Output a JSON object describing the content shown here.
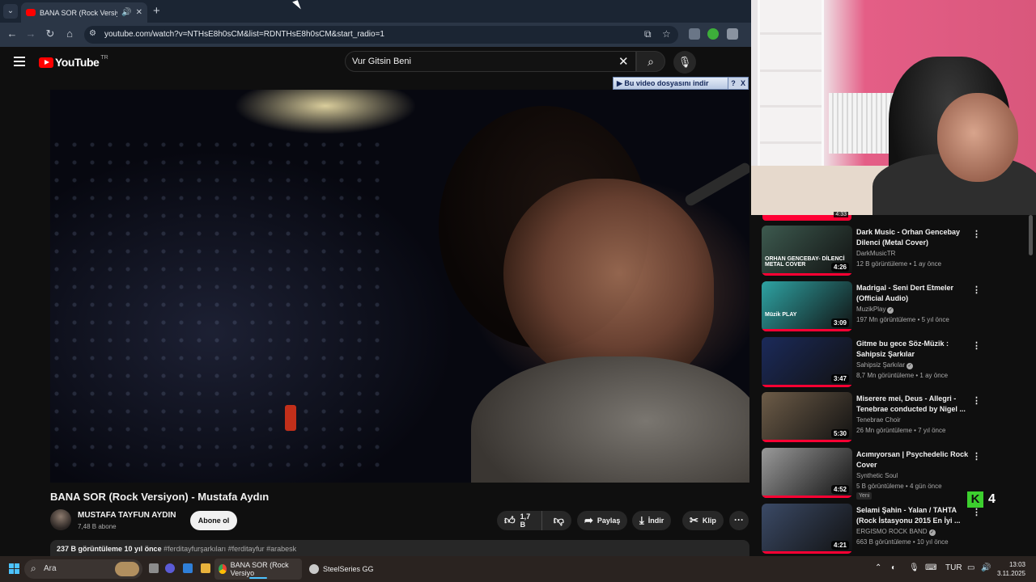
{
  "browser": {
    "tab_title": "BANA SOR (Rock Versiyon)",
    "url": "youtube.com/watch?v=NTHsE8h0sCM&list=RDNTHsE8h0sCM&start_radio=1"
  },
  "yt_header": {
    "logo": "YouTube",
    "country": "TR",
    "search_value": "Vur Gitsin Beni"
  },
  "download_bar": {
    "label": "Bu video dosyasını indir",
    "help": "?",
    "close": "X"
  },
  "video": {
    "title": "BANA SOR (Rock Versiyon) - Mustafa Aydın",
    "channel": "MUSTAFA TAYFUN AYDIN",
    "subscribers": "7,48 B abone",
    "subscribe_label": "Abone ol",
    "likes": "1,7 B",
    "share_label": "Paylaş",
    "download_label": "İndir",
    "clip_label": "Klip",
    "views": "237 B görüntüleme",
    "age": "10 yıl önce",
    "tags": "#ferditayfurşarkıları #ferditayfur #arabesk"
  },
  "recommendations": {
    "top_partial_duration": "4:33",
    "items": [
      {
        "title": "Dark Music - Orhan Gencebay Dilenci (Metal Cover)",
        "channel": "DarkMusicTR",
        "verified": false,
        "meta": "12 B görüntüleme • 1 ay önce",
        "duration": "4:26",
        "thumb_caption": "ORHAN GENCEBAY- DİLENCİ METAL COVER",
        "thumb_color": "#3d5a4f",
        "badge": ""
      },
      {
        "title": "Madrigal - Seni Dert Etmeler (Official Audio)",
        "channel": "MuzikPlay",
        "verified": true,
        "meta": "197 Mn görüntüleme • 5 yıl önce",
        "duration": "3:09",
        "thumb_caption": "Müzik PLAY",
        "thumb_color": "#2ea3a3",
        "badge": ""
      },
      {
        "title": "Gitme bu gece    Söz-Müzik : Sahipsiz Şarkılar",
        "channel": "Sahipsiz Şarkılar",
        "verified": true,
        "meta": "8,7 Mn görüntüleme • 1 ay önce",
        "duration": "3:47",
        "thumb_caption": "",
        "thumb_color": "#1b2a5a",
        "badge": ""
      },
      {
        "title": "Miserere mei, Deus - Allegri - Tenebrae conducted by Nigel ...",
        "channel": "Tenebrae Choir",
        "verified": false,
        "meta": "26 Mn görüntüleme • 7 yıl önce",
        "duration": "5:30",
        "thumb_caption": "",
        "thumb_color": "#6d5c48",
        "badge": ""
      },
      {
        "title": "Acımıyorsan | Psychedelic Rock Cover",
        "channel": "Synthetic Soul",
        "verified": false,
        "meta": "5 B görüntüleme • 4 gün önce",
        "duration": "4:52",
        "thumb_caption": "",
        "thumb_color": "#9a9a9a",
        "badge": "Yeni"
      },
      {
        "title": "Selami Şahin - Yalan / TAHTA (Rock İstasyonu 2015 En İyi ...",
        "channel": "ERGISMO ROCK BAND",
        "verified": true,
        "meta": "663 B görüntüleme • 10 yıl önce",
        "duration": "4:21",
        "thumb_caption": "",
        "thumb_color": "#3b4a66",
        "badge": ""
      }
    ]
  },
  "overlay_counter": {
    "letter": "K",
    "number": "4"
  },
  "taskbar": {
    "search_label": "Ara",
    "apps": [
      {
        "label": "BANA SOR (Rock Versiyo",
        "color": "#e8b23c"
      },
      {
        "label": "SteelSeries GG",
        "color": "#ff6a13"
      }
    ],
    "language": "TUR",
    "time": "13:03",
    "date": "3.11.2025"
  },
  "colors": {
    "yt_red": "#ff0000",
    "progress_red": "#ff0033",
    "taskbar_accent": "#4cc2ff"
  }
}
